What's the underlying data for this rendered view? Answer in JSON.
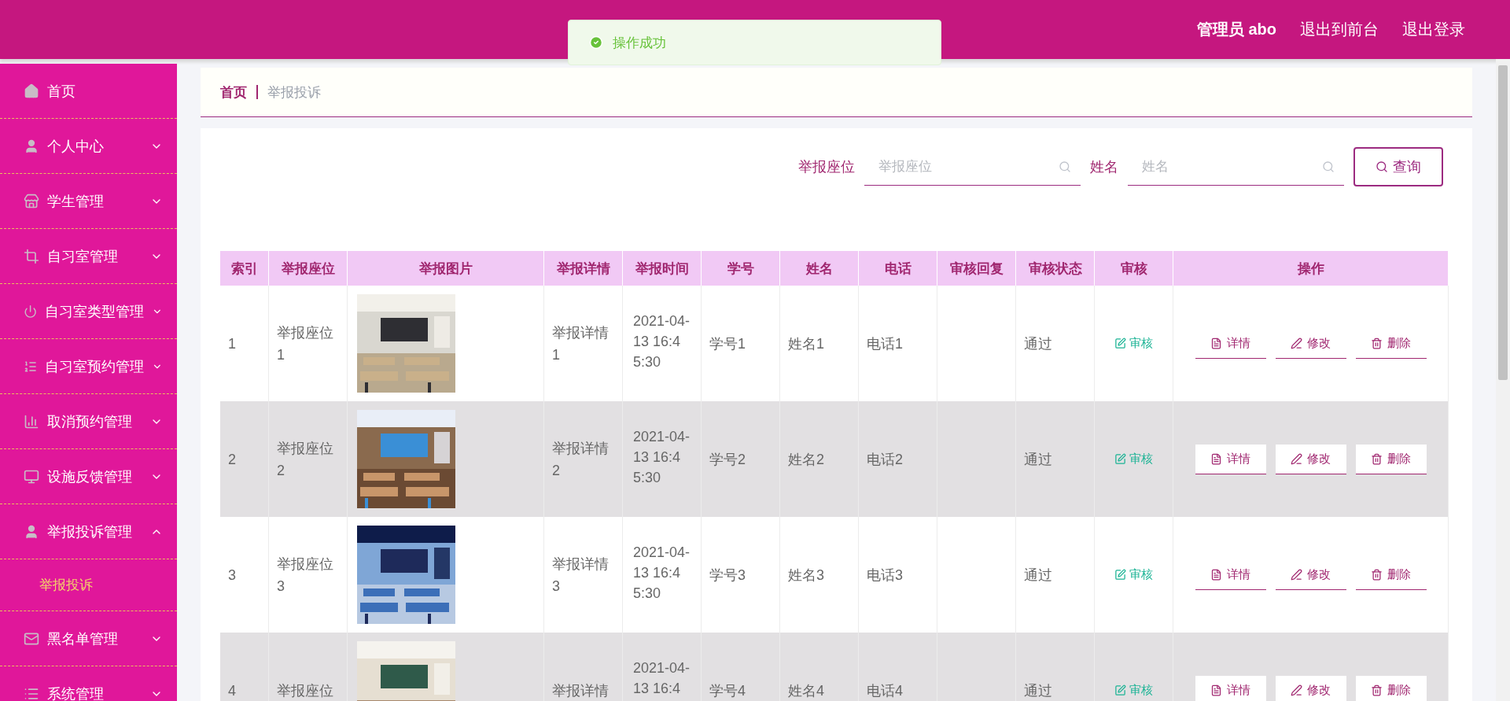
{
  "header": {
    "user_label": "管理员 abo",
    "links": [
      "退出到前台",
      "退出登录"
    ]
  },
  "toast": {
    "text": "操作成功"
  },
  "sidebar": {
    "items": [
      {
        "kind": "link",
        "label": "首页"
      },
      {
        "kind": "menu",
        "label": "个人中心",
        "expanded": false
      },
      {
        "kind": "menu",
        "label": "学生管理",
        "expanded": false
      },
      {
        "kind": "menu",
        "label": "自习室管理",
        "expanded": false
      },
      {
        "kind": "menu",
        "label": "自习室类型管理",
        "expanded": false
      },
      {
        "kind": "menu",
        "label": "自习室预约管理",
        "expanded": false
      },
      {
        "kind": "menu",
        "label": "取消预约管理",
        "expanded": false
      },
      {
        "kind": "menu",
        "label": "设施反馈管理",
        "expanded": false
      },
      {
        "kind": "menu",
        "label": "举报投诉管理",
        "expanded": true,
        "children": [
          {
            "label": "举报投诉",
            "selected": true
          }
        ]
      },
      {
        "kind": "menu",
        "label": "黑名单管理",
        "expanded": false
      },
      {
        "kind": "menu",
        "label": "系统管理",
        "expanded": false
      }
    ]
  },
  "breadcrumb": [
    {
      "label": "首页",
      "current": false
    },
    {
      "label": "举报投诉",
      "current": true
    }
  ],
  "search": {
    "fields": [
      {
        "label": "举报座位",
        "placeholder": "举报座位"
      },
      {
        "label": "姓名",
        "placeholder": "姓名"
      }
    ],
    "button": "查询"
  },
  "table": {
    "columns": [
      "索引",
      "举报座位",
      "举报图片",
      "举报详情",
      "举报时间",
      "学号",
      "姓名",
      "电话",
      "审核回复",
      "审核状态",
      "审核",
      "操作"
    ],
    "rows": [
      {
        "index": "1",
        "seat": "举报座位1",
        "picture": {
          "kind": "picture"
        },
        "detail": "举报详情1",
        "time": "2021-04-13 16:45:30",
        "student_no": "学号1",
        "name": "姓名1",
        "phone": "电话1",
        "status": "通过",
        "review": "审核",
        "actions": [
          "详情",
          "修改",
          "删除"
        ]
      },
      {
        "index": "2",
        "seat": "举报座位2",
        "picture": {
          "kind": "picture"
        },
        "detail": "举报详情2",
        "time": "2021-04-13 16:45:30",
        "student_no": "学号2",
        "name": "姓名2",
        "phone": "电话2",
        "status": "通过",
        "review": "审核",
        "actions": [
          "详情",
          "修改",
          "删除"
        ]
      },
      {
        "index": "3",
        "seat": "举报座位3",
        "picture": {
          "kind": "picture"
        },
        "detail": "举报详情3",
        "time": "2021-04-13 16:45:30",
        "student_no": "学号3",
        "name": "姓名3",
        "phone": "电话3",
        "status": "通过",
        "review": "审核",
        "actions": [
          "详情",
          "修改",
          "删除"
        ]
      },
      {
        "index": "4",
        "seat": "举报座位",
        "picture": {
          "kind": "picture"
        },
        "detail": "举报详情",
        "time": "2021-04-13 16:4",
        "student_no": "学号4",
        "name": "姓名4",
        "phone": "电话4",
        "status": "通过",
        "review": "审核",
        "actions": [
          "详情",
          "修改",
          "删除"
        ]
      }
    ]
  }
}
